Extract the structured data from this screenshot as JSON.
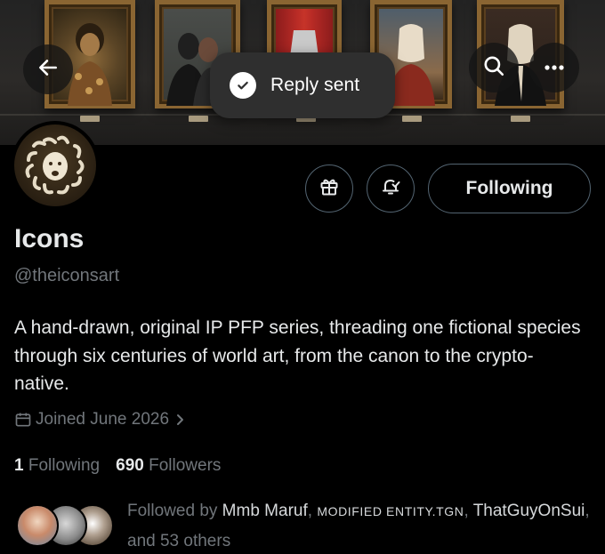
{
  "header": {
    "back_icon": "arrow-left-icon",
    "search_icon": "search-icon",
    "more_icon": "more-horizontal-icon"
  },
  "toast": {
    "icon": "check-circle-icon",
    "message": "Reply sent"
  },
  "profile": {
    "name": "Icons",
    "handle": "@theiconsart",
    "bio": "A hand-drawn, original IP PFP series, threading one fictional species through six centuries of world art, from the canon to the crypto-native.",
    "joined": "Joined June 2026"
  },
  "actions": {
    "gift_icon": "gift-icon",
    "notify_icon": "bell-check-icon",
    "follow_label": "Following"
  },
  "stats": {
    "following_count": "1",
    "following_label": "Following",
    "followers_count": "690",
    "followers_label": "Followers"
  },
  "followed_by": {
    "prefix": "Followed by",
    "user1": "Mmb Maruf",
    "sep1": ",",
    "user2": "MODIFIED ENTITY.TGN",
    "sep2": ",",
    "user3": "ThatGuyOnSui",
    "sep3": ",",
    "suffix": "and 53 others"
  },
  "colors": {
    "background": "#000000",
    "text_primary": "#e7e9ea",
    "text_secondary": "#71767b",
    "border": "#536471",
    "toast_bg": "#2f2f2f"
  }
}
